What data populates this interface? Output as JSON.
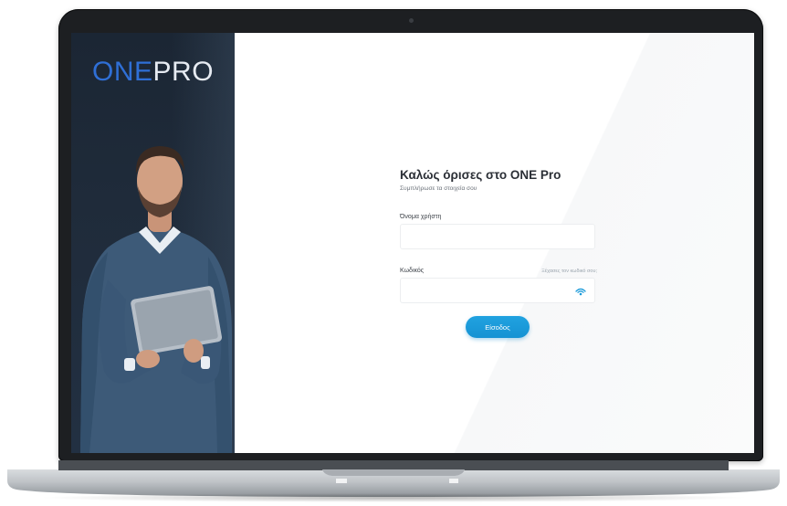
{
  "brand": {
    "logo_part1": "ONE",
    "logo_part2": "PRO",
    "accent_color": "#2f6fd6"
  },
  "login": {
    "title": "Καλώς όρισες στο ONE Pro",
    "subtitle": "Συμπλήρωσε τα στοιχεία σου",
    "username_label": "Όνομα χρήστη",
    "username_value": "",
    "password_label": "Κωδικός",
    "password_value": "",
    "forgot_password": "Ξέχασες τον κωδικό σου;",
    "submit_label": "Είσοδος",
    "button_color": "#1a9ad9"
  },
  "icons": {
    "password_toggle": "eye-icon"
  }
}
